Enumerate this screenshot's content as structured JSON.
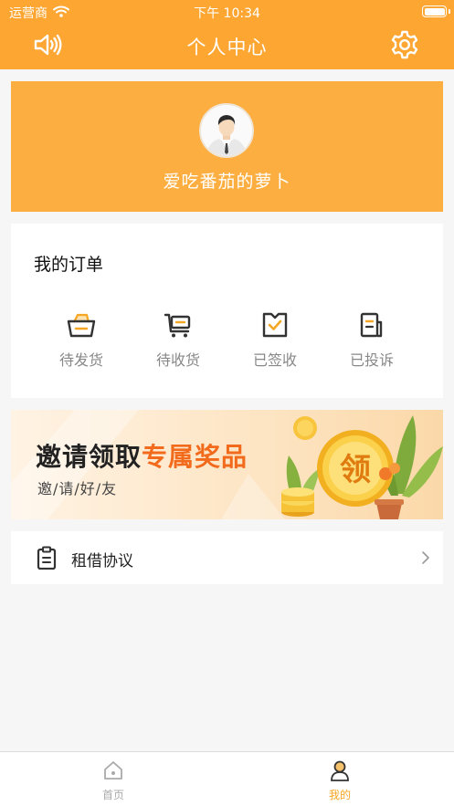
{
  "status_bar": {
    "carrier": "运营商",
    "time": "下午 10:34"
  },
  "nav": {
    "title": "个人中心",
    "left_icon": "speaker-icon",
    "right_icon": "gear-icon"
  },
  "profile": {
    "username": "爱吃番茄的萝卜"
  },
  "orders": {
    "title": "我的订单",
    "items": [
      {
        "label": "待发货",
        "icon": "basket-icon"
      },
      {
        "label": "待收货",
        "icon": "cart-icon"
      },
      {
        "label": "已签收",
        "icon": "signed-check-icon"
      },
      {
        "label": "已投诉",
        "icon": "document-icon"
      }
    ]
  },
  "banner": {
    "title_part1": "邀请领取",
    "title_part2": "专属奖品",
    "subtitle": "邀/请/好/友",
    "coin_text": "领"
  },
  "agreement": {
    "label": "租借协议"
  },
  "tabbar": {
    "tabs": [
      {
        "label": "首页",
        "active": false
      },
      {
        "label": "我的",
        "active": true
      }
    ]
  },
  "colors": {
    "brand": "#fda632",
    "card": "#fdae40",
    "accent": "#f26b1d",
    "inactive": "#aaaaaa"
  }
}
